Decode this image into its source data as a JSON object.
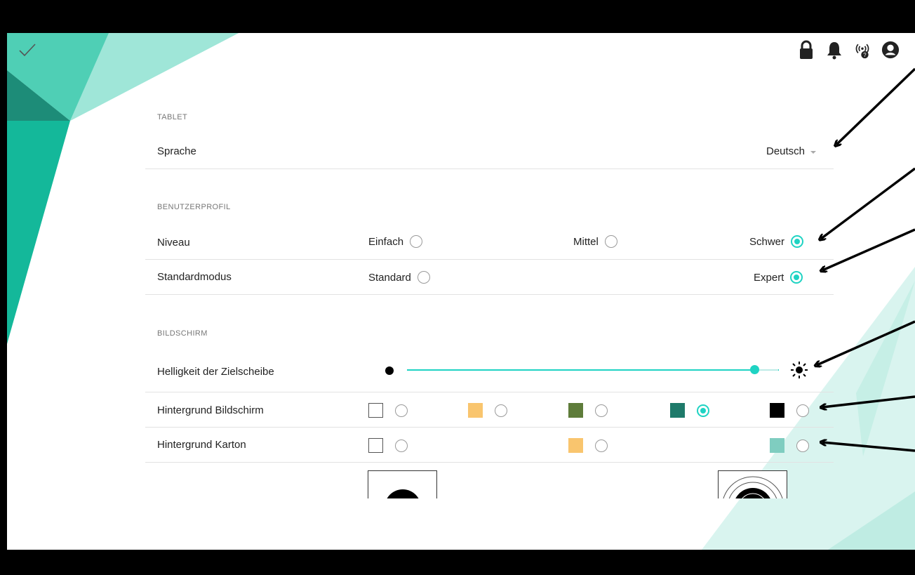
{
  "topbar": {
    "confirm_icon": "check-icon",
    "icons": [
      "lock-icon",
      "bell-icon",
      "wireless-help-icon",
      "account-icon"
    ]
  },
  "tablet": {
    "section_title": "TABLET",
    "language_label": "Sprache",
    "language_value": "Deutsch"
  },
  "profile": {
    "section_title": "BENUTZERPROFIL",
    "level": {
      "label": "Niveau",
      "options": [
        "Einfach",
        "Mittel",
        "Schwer"
      ],
      "selected": "Schwer"
    },
    "mode": {
      "label": "Standardmodus",
      "options": [
        "Standard",
        "Expert"
      ],
      "selected": "Expert"
    }
  },
  "screen": {
    "section_title": "BILDSCHIRM",
    "brightness": {
      "label": "Helligkeit der Zielscheibe",
      "level": 0.95
    },
    "background_screen": {
      "label": "Hintergrund Bildschirm",
      "colors": [
        "#ffffff",
        "#f9c56e",
        "#5e7c3a",
        "#1e7a6a",
        "#000000"
      ],
      "selected_index": 3
    },
    "background_card": {
      "label": "Hintergrund Karton",
      "colors": [
        "#ffffff",
        "#f9c56e",
        "#7fcdc0"
      ],
      "selected_index": -1
    }
  },
  "colors": {
    "accent": "#1fd3c3",
    "deco_teal": "#21c2a6"
  }
}
